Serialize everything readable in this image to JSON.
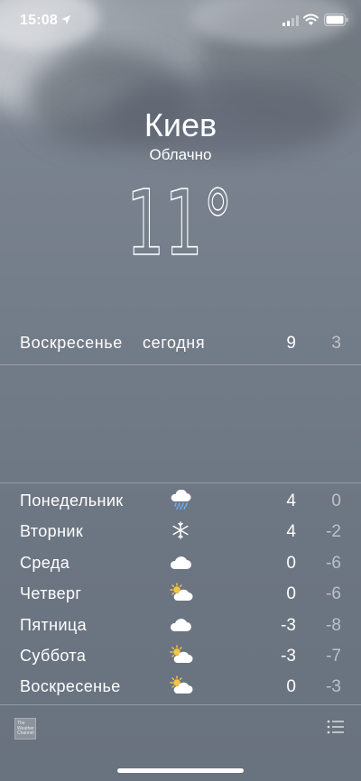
{
  "status_bar": {
    "time": "15:08",
    "icons": [
      "location-arrow-icon",
      "cellular-signal-icon",
      "wifi-icon",
      "battery-icon"
    ]
  },
  "location": {
    "city": "Киев",
    "condition": "Облачно",
    "temperature": "11°"
  },
  "today": {
    "day": "Воскресенье",
    "label": "сегодня",
    "high": "9",
    "low": "3"
  },
  "forecast": [
    {
      "day": "Понедельник",
      "icon": "rain-icon",
      "high": "4",
      "low": "0"
    },
    {
      "day": "Вторник",
      "icon": "snowflake-icon",
      "high": "4",
      "low": "-2"
    },
    {
      "day": "Среда",
      "icon": "cloud-icon",
      "high": "0",
      "low": "-6"
    },
    {
      "day": "Четверг",
      "icon": "partly-sunny-icon",
      "high": "0",
      "low": "-6"
    },
    {
      "day": "Пятница",
      "icon": "cloud-icon",
      "high": "-3",
      "low": "-8"
    },
    {
      "day": "Суббота",
      "icon": "partly-sunny-icon",
      "high": "-3",
      "low": "-7"
    },
    {
      "day": "Воскресенье",
      "icon": "partly-sunny-icon",
      "high": "0",
      "low": "-3"
    }
  ],
  "footer": {
    "provider_logo": "The Weather Channel",
    "list_icon": "list-icon"
  },
  "colors": {
    "background_top": "#7f8792",
    "background_bottom": "#69727f",
    "text": "#ffffff",
    "sun": "#f4c542",
    "rain": "#6fb3ff"
  }
}
